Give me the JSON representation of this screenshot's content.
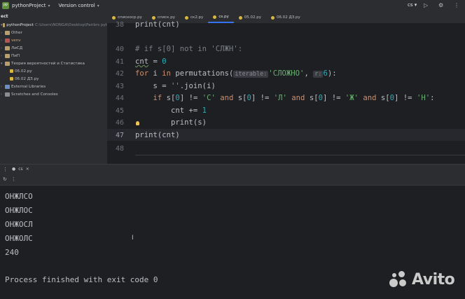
{
  "titlebar": {
    "project_badge": "PP",
    "project_name": "pythonProject",
    "vcs_label": "Version control",
    "run_config": "cs"
  },
  "project_panel": {
    "header": "ect",
    "items": [
      {
        "label": "pythonProject",
        "extra": "C:\\Users\\NONGA\\Desktop\\Pairbrs pyt",
        "type": "folder"
      },
      {
        "label": "Other",
        "type": "folder"
      },
      {
        "label": "venv",
        "type": "folder-red"
      },
      {
        "label": "ЛиСД",
        "type": "folder"
      },
      {
        "label": "ПиП",
        "type": "folder"
      },
      {
        "label": "Теория вероятностей и Статистика",
        "type": "folder"
      },
      {
        "label": "06.02.py",
        "type": "py"
      },
      {
        "label": "06.02 ДЗ.py",
        "type": "py"
      },
      {
        "label": "External Libraries",
        "type": "lib"
      },
      {
        "label": "Scratches and Consoles",
        "type": "lib"
      }
    ]
  },
  "tabs": [
    {
      "label": "спискоср.py"
    },
    {
      "label": "списк.py"
    },
    {
      "label": "ск2.py"
    },
    {
      "label": "cs.py",
      "active": true
    },
    {
      "label": "05.02.py"
    },
    {
      "label": "06.02 ДЗ.py"
    }
  ],
  "editor": {
    "line_numbers": [
      "38",
      "40",
      "41",
      "42",
      "43",
      "44",
      "45",
      "46",
      "47",
      "48"
    ],
    "lines": {
      "l38": "print(cnt)",
      "l40": "# if s[0] not in 'СЛЖН':",
      "l41_var": "cnt",
      "l41_rest": " = ",
      "l41_num": "0",
      "l42_kw": "for",
      "l42_a": " i ",
      "l42_in": "in",
      "l42_b": " permutations(",
      "l42_hint1": "iterable:",
      "l42_str": "'СЛОЖНО'",
      "l42_c": ", ",
      "l42_hint2": "r:",
      "l42_num": "6",
      "l42_d": "):",
      "l43_a": "    s = ",
      "l43_str": "''",
      "l43_b": ".join(i)",
      "l44_kw": "    if",
      "l44_a": " s[",
      "l44_n1": "0",
      "l44_b": "] != ",
      "l44_s1": "'С'",
      "l44_and1": " and",
      "l44_c": " s[",
      "l44_n2": "0",
      "l44_d": "] != ",
      "l44_s2": "'Л'",
      "l44_and2": " and",
      "l44_e": " s[",
      "l44_n3": "0",
      "l44_f": "] != ",
      "l44_s3": "'Ж'",
      "l44_and3": " and",
      "l44_g": " s[",
      "l44_n4": "0",
      "l44_h": "] != ",
      "l44_s4": "'Н'",
      "l44_i": ":",
      "l45_a": "        cnt += ",
      "l45_num": "1",
      "l46": "        print(s)",
      "l47": "print(cnt)"
    }
  },
  "run_panel": {
    "tab_label": "cs",
    "output": [
      "ОНЖЛСО",
      "ОНЖЛОС",
      "ОНЖОСЛ",
      "ОНЖОЛС",
      "240",
      "",
      "Process finished with exit code 0"
    ]
  },
  "watermark": {
    "text": "Avito"
  },
  "colors": {
    "accent": "#3574f0",
    "keyword": "#cf8e6d",
    "string": "#6aab73",
    "number": "#2aacb8"
  }
}
